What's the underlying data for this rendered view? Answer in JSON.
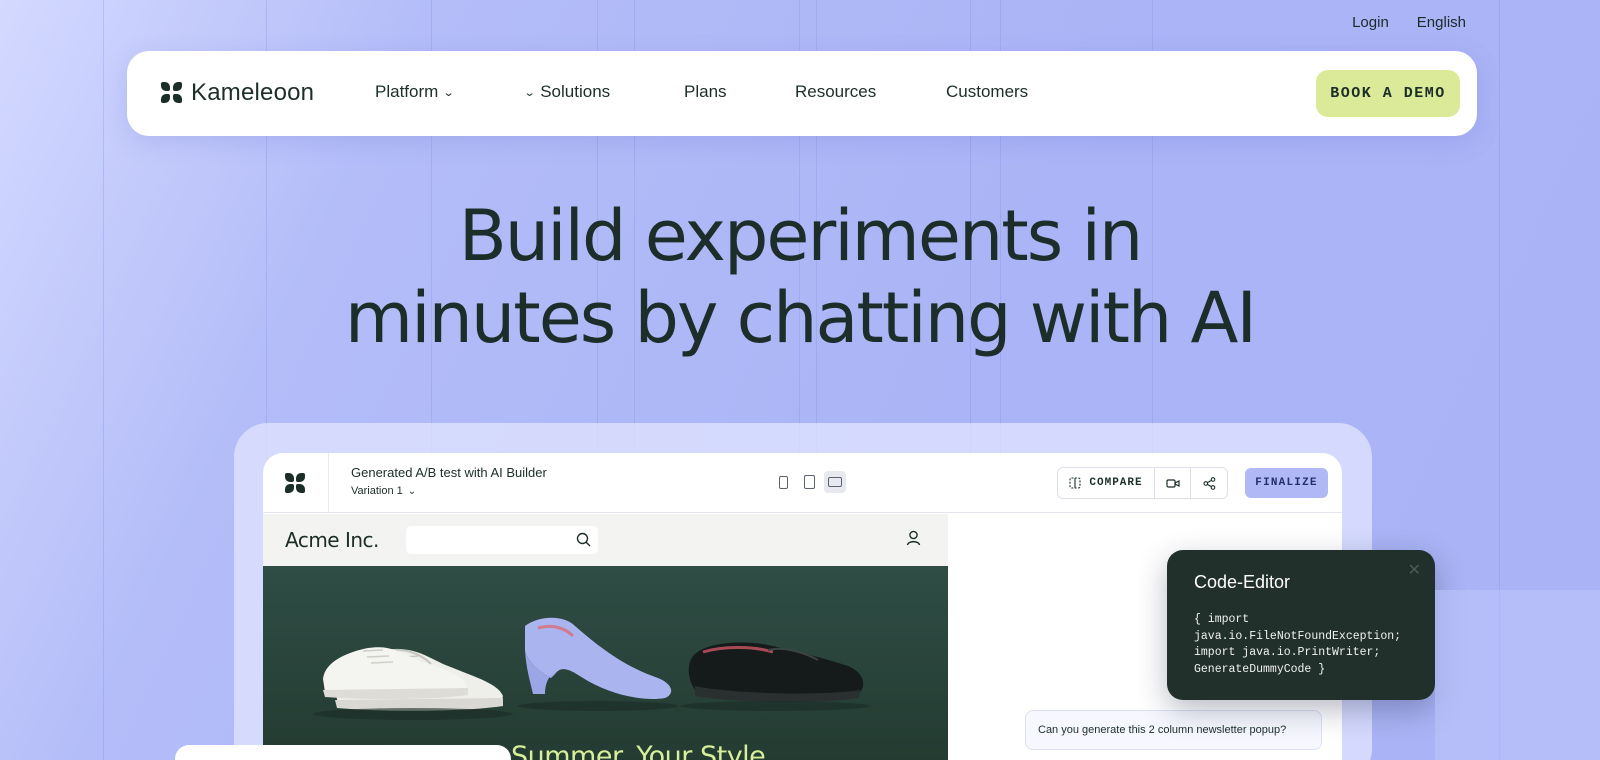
{
  "top_links": {
    "login": "Login",
    "language": "English"
  },
  "nav": {
    "brand": "Kameleoon",
    "items": [
      {
        "label": "Platform"
      },
      {
        "label": "Solutions"
      },
      {
        "label": "Plans"
      },
      {
        "label": "Resources"
      },
      {
        "label": "Customers"
      }
    ],
    "cta": "BOOK A DEMO"
  },
  "hero": {
    "line1": "Build experiments in",
    "line2": "minutes by chatting with AI"
  },
  "app": {
    "title": "Generated A/B test with AI Builder",
    "variation": "Variation 1",
    "toolbar": {
      "compare": "COMPARE",
      "finalize": "FINALIZE"
    },
    "site": {
      "brand": "Acme Inc.",
      "banner_headline": "Summer. Your Style"
    },
    "chat_prompt": "Can you generate this 2 column newsletter popup?"
  },
  "code_editor": {
    "title": "Code-Editor",
    "code": "{ import java.io.FileNotFoundException;\nimport java.io.PrintWriter;\nGenerateDummyCode }"
  },
  "colors": {
    "accent_lime": "#dbea98",
    "primary_dark": "#1c2e28",
    "background": "#b3bcf7",
    "finalize": "#b0b9f5"
  }
}
